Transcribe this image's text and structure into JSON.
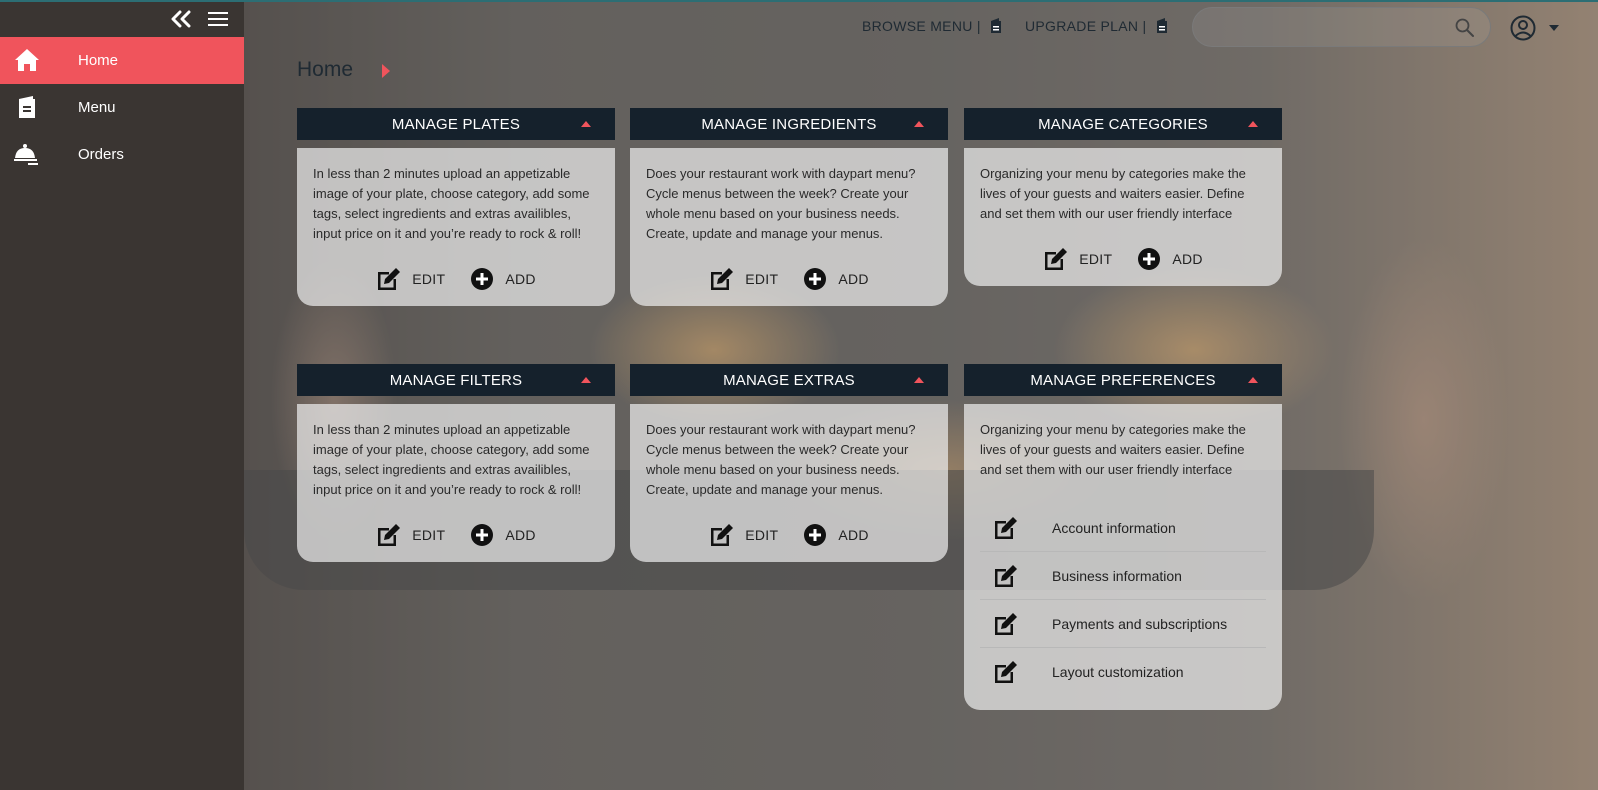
{
  "sidebar": {
    "items": [
      {
        "label": "Home",
        "icon": "home-icon",
        "active": true
      },
      {
        "label": "Menu",
        "icon": "menu-book-icon",
        "active": false
      },
      {
        "label": "Orders",
        "icon": "cloche-icon",
        "active": false
      }
    ]
  },
  "header": {
    "browse_menu": "BROWSE MENU |",
    "upgrade_plan": "UPGRADE PLAN |",
    "search_placeholder": ""
  },
  "page": {
    "title": "Home"
  },
  "cards": [
    {
      "title": "MANAGE PLATES",
      "desc": "In less than 2 minutes upload an appetizable image of your plate, choose category, add some tags, select ingredients and extras availibles, input price on it and you’re ready to rock & roll!",
      "edit": "EDIT",
      "add": "ADD"
    },
    {
      "title": "MANAGE INGREDIENTS",
      "desc": "Does your restaurant work with daypart menu? Cycle menus between the week? Create your whole menu based on your business needs. Create, update and manage your menus.",
      "edit": "EDIT",
      "add": "ADD"
    },
    {
      "title": "MANAGE CATEGORIES",
      "desc": "Organizing your menu by categories make the lives of your guests and waiters easier. Define and set them with our user friendly interface",
      "edit": "EDIT",
      "add": "ADD"
    },
    {
      "title": "MANAGE FILTERS",
      "desc": "In less than 2 minutes upload an appetizable image of your plate, choose category, add some tags, select ingredients and extras availibles, input price on it and you’re ready to rock & roll!",
      "edit": "EDIT",
      "add": "ADD"
    },
    {
      "title": "MANAGE EXTRAS",
      "desc": "Does your restaurant work with daypart menu? Cycle menus between the week? Create your whole menu based on your business needs. Create, update and manage your menus.",
      "edit": "EDIT",
      "add": "ADD"
    },
    {
      "title": "MANAGE PREFERENCES",
      "desc": "Organizing your menu by categories make the lives of your guests and waiters easier. Define and set them with our user friendly interface"
    }
  ],
  "preferences": [
    "Account information",
    "Business information",
    "Payments and subscriptions",
    "Layout customization"
  ],
  "colors": {
    "accent": "#f0545c",
    "header_dark": "#15212c",
    "sidebar": "#3a3532"
  }
}
